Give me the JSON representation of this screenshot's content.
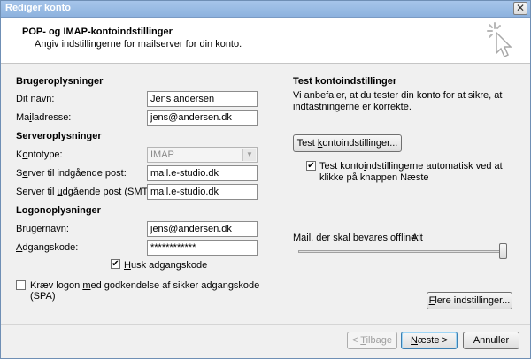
{
  "window": {
    "title": "Rediger konto",
    "close_glyph": "✕"
  },
  "header": {
    "title": "POP- og IMAP-kontoindstillinger",
    "subtitle": "Angiv indstillingerne for mailserver for din konto.",
    "icon": "cursor-sparkle-icon"
  },
  "user": {
    "group": "Brugeroplysninger",
    "name_label_u": "D",
    "name_label_rest": "it navn:",
    "name_value": "Jens andersen",
    "email_label_a": "Ma",
    "email_label_u": "i",
    "email_label_b": "ladresse:",
    "email_value": "jens@andersen.dk"
  },
  "server": {
    "group": "Serveroplysninger",
    "type_label_a": "K",
    "type_label_u": "o",
    "type_label_b": "ntotype:",
    "type_value": "IMAP",
    "in_label_a": "S",
    "in_label_u": "e",
    "in_label_b": "rver til indgående post:",
    "in_value": "mail.e-studio.dk",
    "out_label_a": "Server til ",
    "out_label_u": "u",
    "out_label_b": "dgående post (SMTP):",
    "out_value": "mail.e-studio.dk"
  },
  "logon": {
    "group": "Logonoplysninger",
    "user_label_a": "Brugern",
    "user_label_u": "a",
    "user_label_b": "vn:",
    "user_value": "jens@andersen.dk",
    "pass_label_u": "A",
    "pass_label_b": "dgangskode:",
    "pass_value": "************",
    "remember_label_u": "H",
    "remember_label_b": "usk adgangskode",
    "remember_checked": "✔",
    "spa_label_a": "Kræv logon ",
    "spa_label_u": "m",
    "spa_label_b": "ed godkendelse af sikker adgangskode (SPA)",
    "spa_checked": ""
  },
  "test": {
    "group": "Test kontoindstillinger",
    "description": "Vi anbefaler, at du tester din konto for at sikre, at indtastningerne er korrekte.",
    "button_a": "Test ",
    "button_u": "k",
    "button_b": "ontoindstillinger...",
    "auto_label_a": "Test konto",
    "auto_label_u": "i",
    "auto_label_b": "ndstillingerne automatisk ved at klikke på knappen Næste",
    "auto_checked": "✔"
  },
  "offline": {
    "label": "Mail, der skal bevares offline:",
    "value_label": "Alt",
    "slider_fraction": 1.0
  },
  "more_button_u": "F",
  "more_button_b": "lere indstillinger...",
  "footer": {
    "back_a": "< ",
    "back_u": "T",
    "back_b": "ilbage",
    "next_a": "",
    "next_u": "N",
    "next_b": "æste >",
    "cancel": "Annuller"
  }
}
